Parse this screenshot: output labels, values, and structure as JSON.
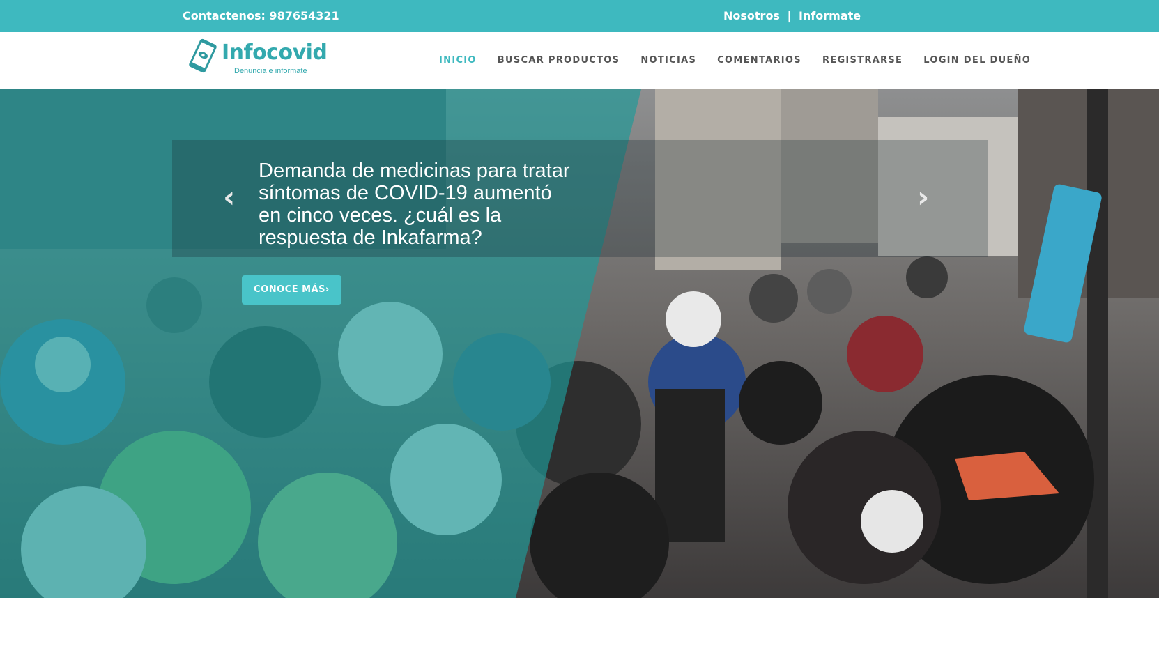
{
  "topbar": {
    "contact": "Contactenos: 987654321",
    "links": [
      "Nosotros",
      "Informate"
    ],
    "separator": "|"
  },
  "logo": {
    "name": "Infocovid",
    "tagline": "Denuncia e informate"
  },
  "nav": {
    "items": [
      "INICIO",
      "BUSCAR PRODUCTOS",
      "NOTICIAS",
      "COMENTARIOS",
      "REGISTRARSE",
      "LOGIN DEL DUEÑO"
    ],
    "active": "INICIO"
  },
  "hero": {
    "headline": "Demanda de medicinas para tratar síntomas de COVID-19 aumentó en cinco veces. ¿cuál es la respuesta de Inkafarma?",
    "cta": "CONOCE MÁS›",
    "prev_icon": "‹",
    "next_icon": "›"
  },
  "colors": {
    "accent": "#3eb9bf",
    "nav_text": "#555555",
    "button": "#49c4c9"
  },
  "icons": {
    "logo": "phone-eye-icon",
    "prev": "chevron-left-icon",
    "next": "chevron-right-icon"
  }
}
